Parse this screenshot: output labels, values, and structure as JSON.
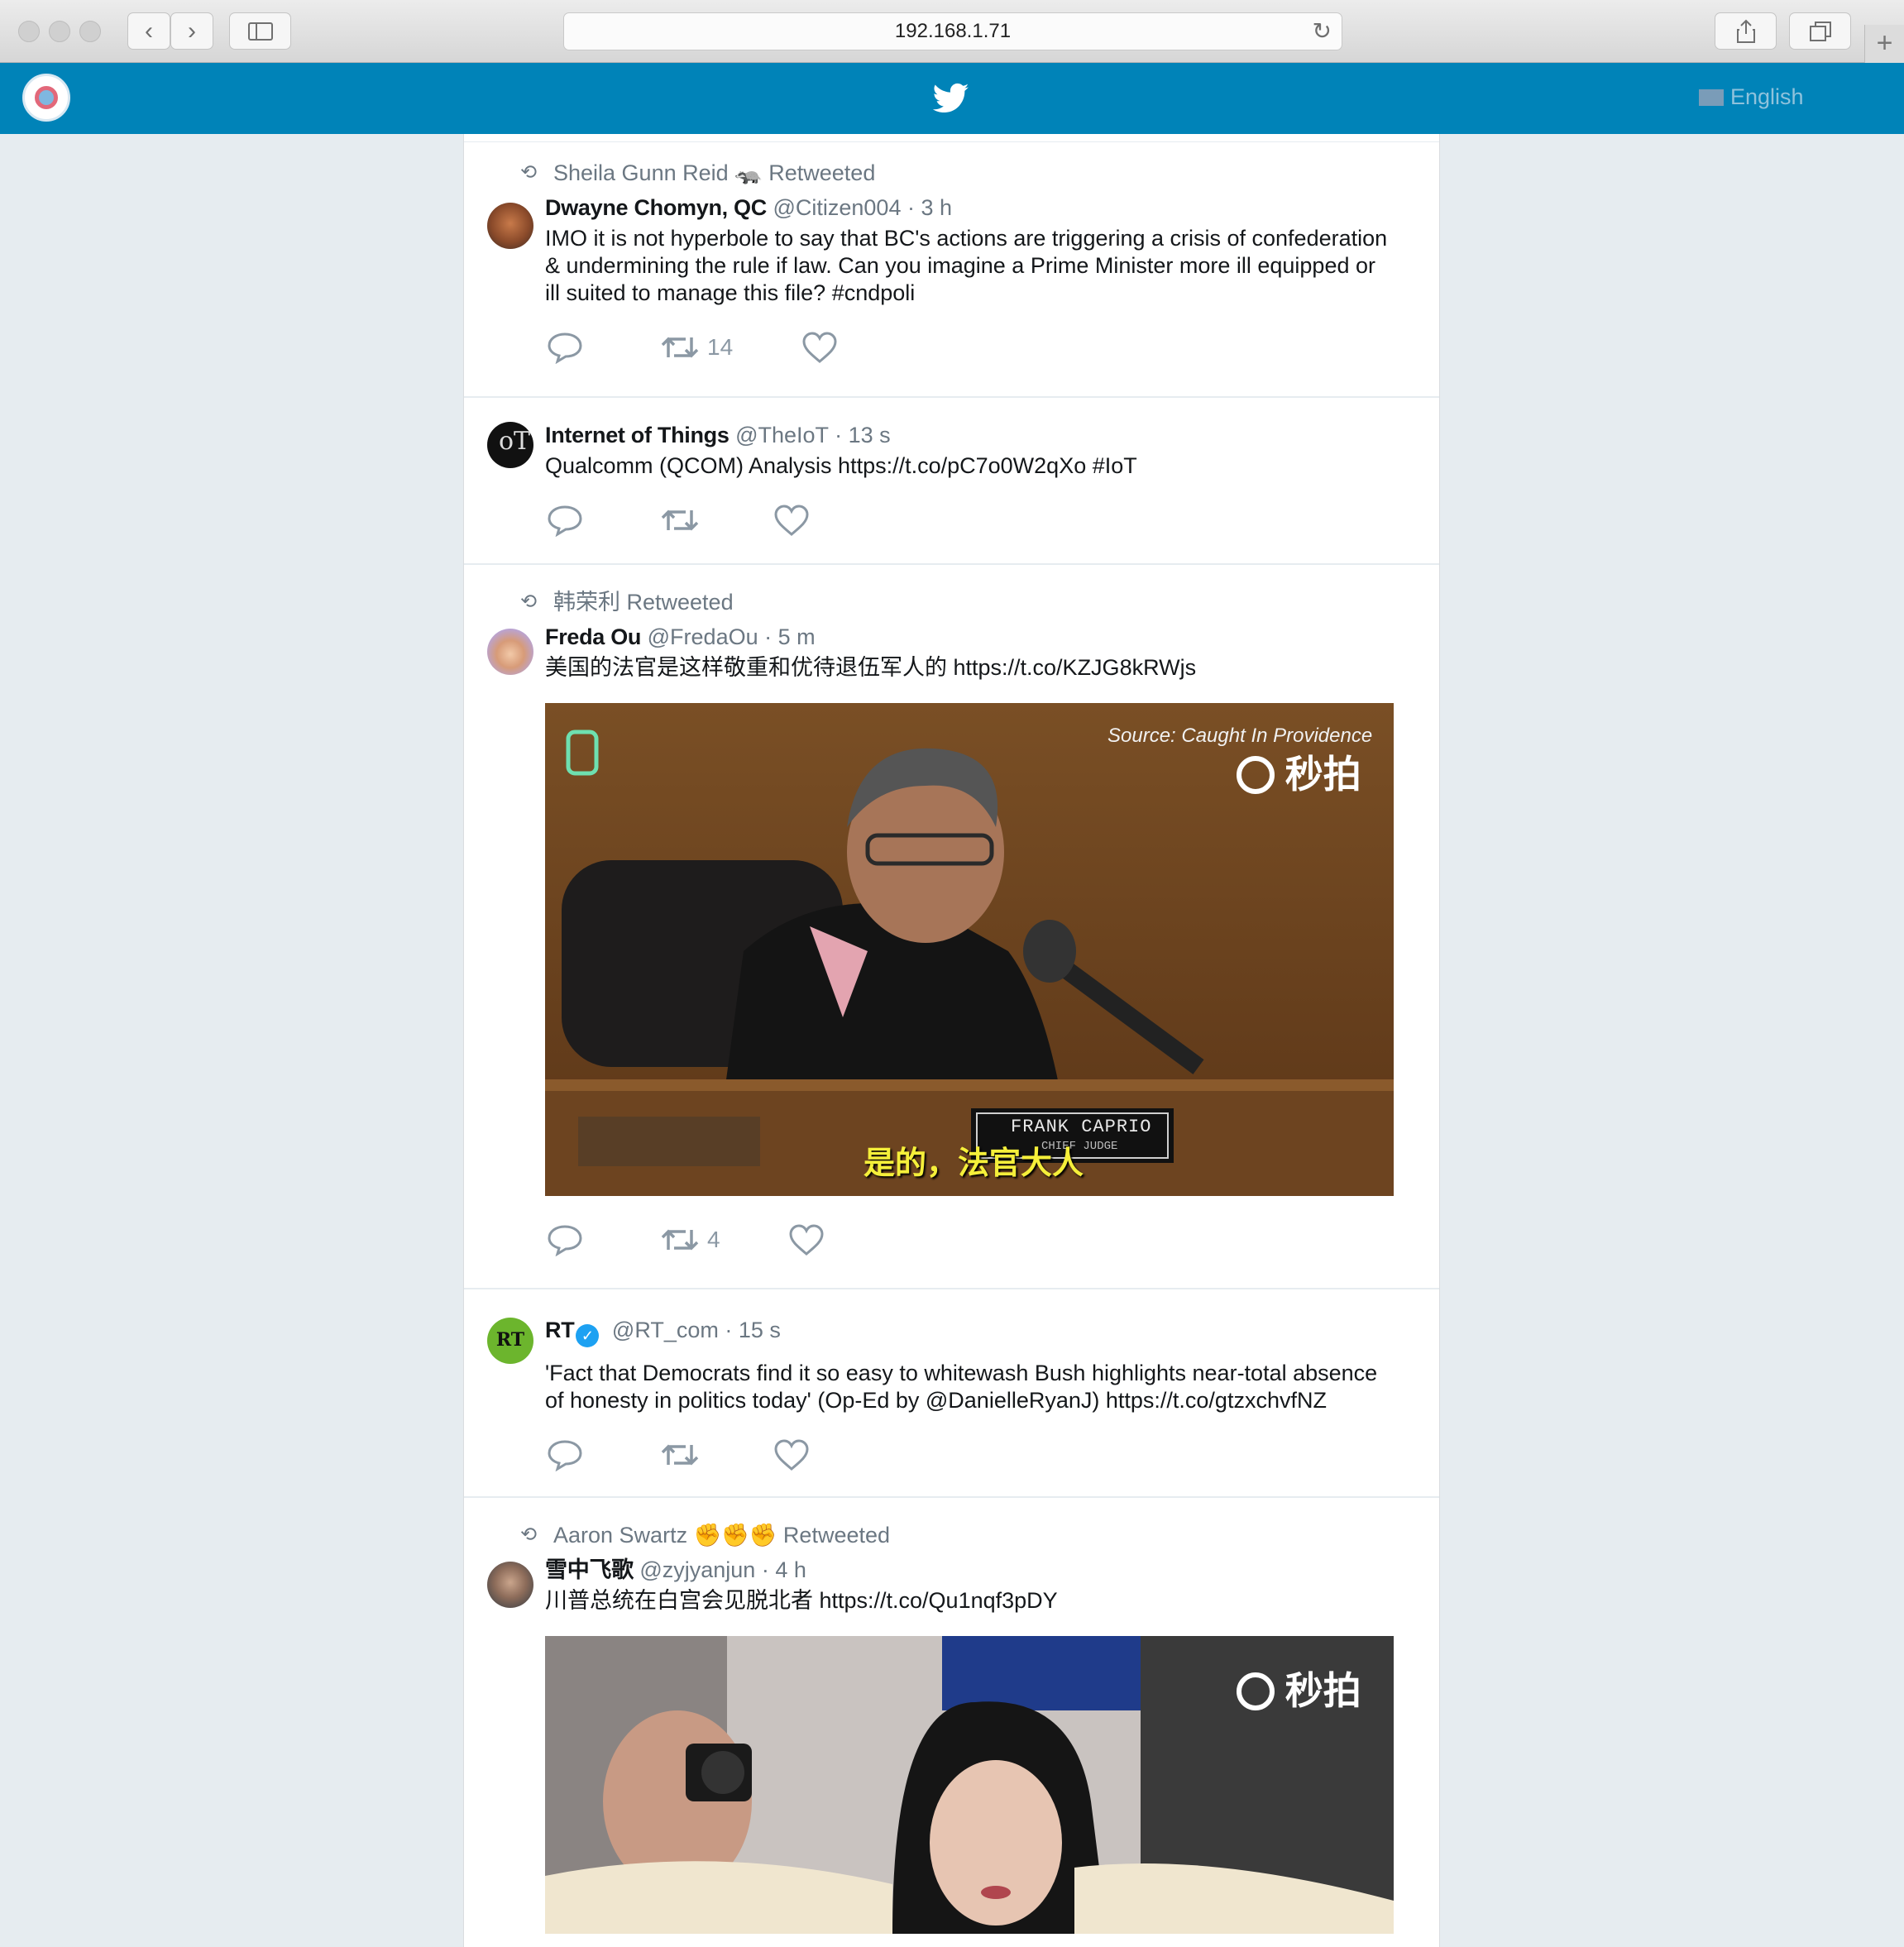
{
  "browser": {
    "url": "192.168.1.71"
  },
  "header": {
    "language": "English"
  },
  "icons": {
    "reply": "reply-icon",
    "retweet": "retweet-icon",
    "like": "heart-icon",
    "twitter": "twitter-bird-icon",
    "verified": "verified-badge-icon"
  },
  "colors": {
    "appbar": "#0083b8",
    "page_background": "#e6ecf0",
    "muted_text": "#6b7782",
    "action_gray": "#8b98a4",
    "verified": "#1da1f2"
  },
  "tweets": [
    {
      "retweeted_by": "Sheila Gunn Reid 🦡 Retweeted",
      "name": "Dwayne Chomyn, QC",
      "handle": "@Citizen004",
      "time": "· 3 h",
      "text": "IMO it is not hyperbole to say that BC's actions are triggering a crisis of confederation & undermining the rule if law. Can you imagine a Prime Minister more ill equipped or ill suited to manage this file? #cndpoli",
      "retweets": "14"
    },
    {
      "name": "Internet of Things",
      "handle": "@TheIoT",
      "time": "· 13 s",
      "text": "Qualcomm (QCOM) Analysis https://t.co/pC7o0W2qXo #IoT"
    },
    {
      "retweeted_by": "韩荣利 Retweeted",
      "name": "Freda Ou",
      "handle": "@FredaOu",
      "time": "· 5 m",
      "text": "美国的法官是这样敬重和优待退伍军人的 https://t.co/KZJG8kRWjs",
      "media": {
        "source_text": "Source: Caught In Providence",
        "watermark": "秒拍",
        "nameplate_name": "FRANK CAPRIO",
        "nameplate_title": "CHIEF JUDGE",
        "subtitle": "是的，法官大人"
      },
      "retweets": "4"
    },
    {
      "name": "RT",
      "handle": "@RT_com",
      "time": "· 15 s",
      "avatar_text": "RT",
      "text": "'Fact that Democrats find it so easy to whitewash Bush highlights near-total absence of honesty in politics today' (Op-Ed by @DanielleRyanJ) https://t.co/gtzxchvfNZ"
    },
    {
      "retweeted_by": "Aaron Swartz ✊✊✊ Retweeted",
      "name": "雪中飞歌",
      "handle": "@zyjyanjun",
      "time": "· 4 h",
      "text": "川普总统在白宫会见脱北者 https://t.co/Qu1nqf3pDY",
      "media": {
        "watermark": "秒拍"
      }
    }
  ]
}
